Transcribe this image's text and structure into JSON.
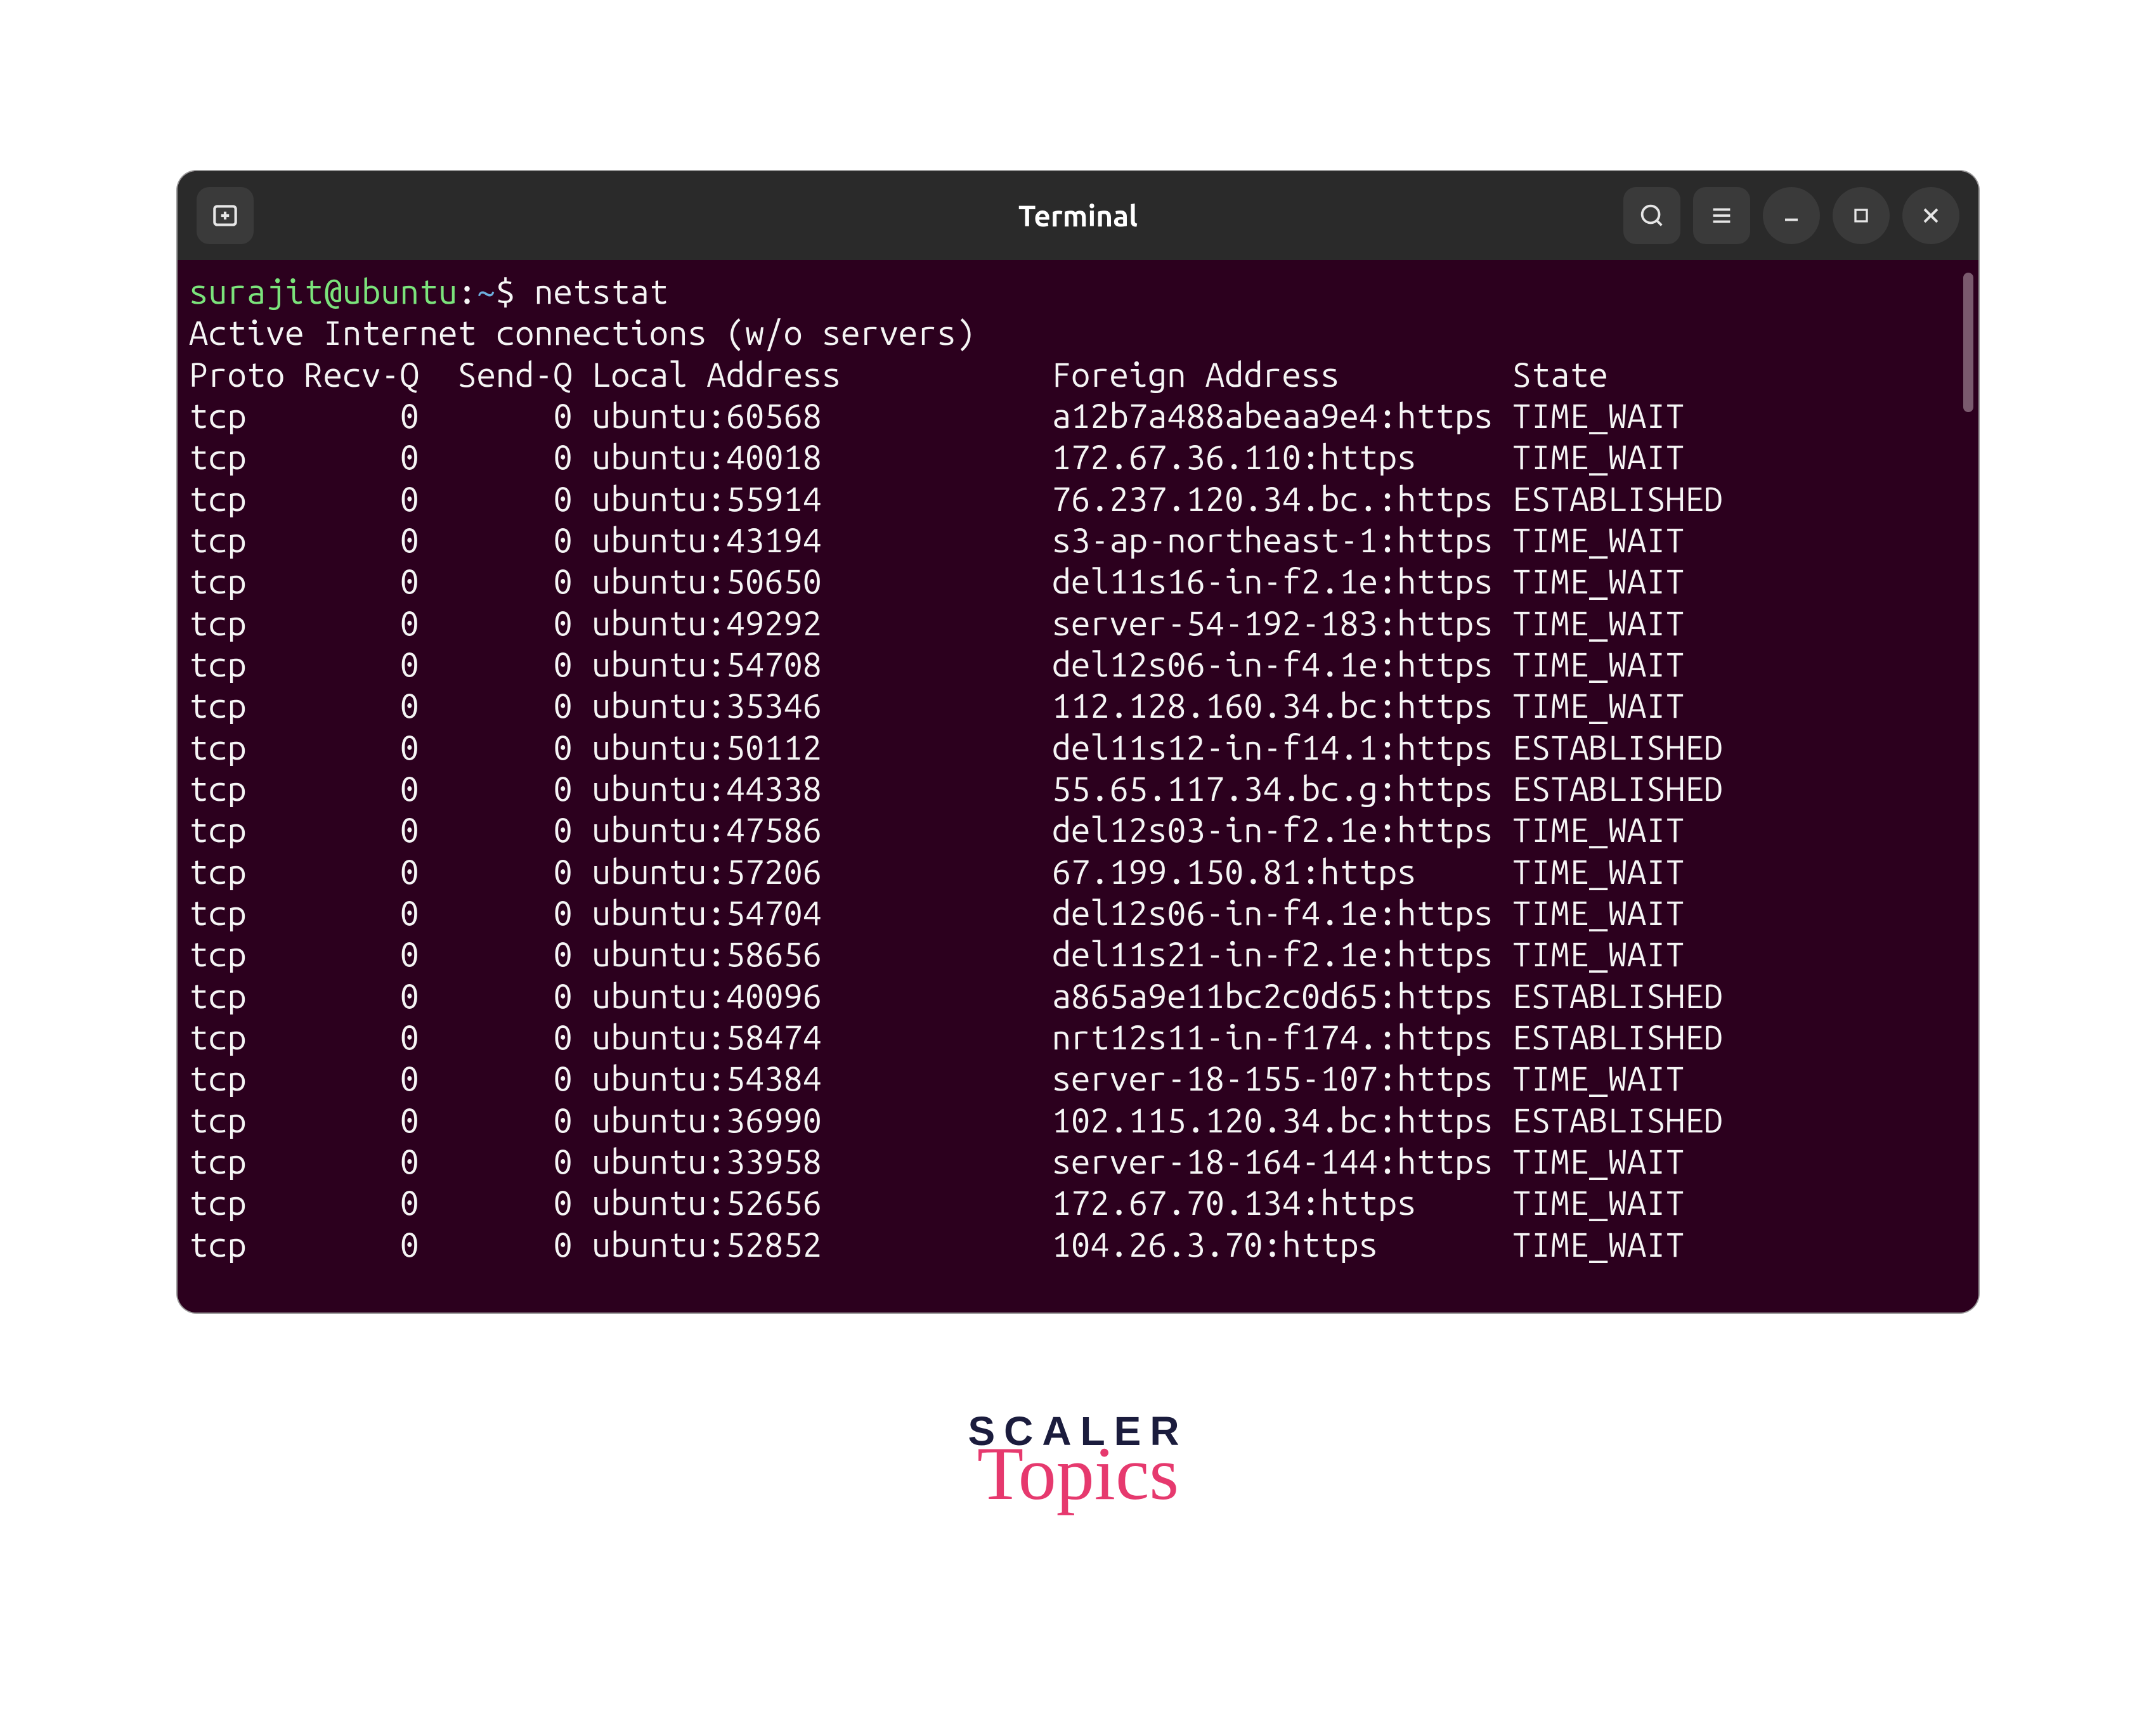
{
  "window": {
    "title": "Terminal"
  },
  "prompt": {
    "user": "surajit@ubuntu",
    "sep": ":",
    "path": "~",
    "dollar": "$",
    "command": "netstat"
  },
  "output_header": "Active Internet connections (w/o servers)",
  "columns": {
    "proto": "Proto",
    "recvq": "Recv-Q",
    "sendq": "Send-Q",
    "local": "Local Address",
    "foreign": "Foreign Address",
    "state": "State"
  },
  "rows": [
    {
      "proto": "tcp",
      "recvq": "0",
      "sendq": "0",
      "local": "ubuntu:60568",
      "foreign": "a12b7a488abeaa9e4:https",
      "state": "TIME_WAIT"
    },
    {
      "proto": "tcp",
      "recvq": "0",
      "sendq": "0",
      "local": "ubuntu:40018",
      "foreign": "172.67.36.110:https",
      "state": "TIME_WAIT"
    },
    {
      "proto": "tcp",
      "recvq": "0",
      "sendq": "0",
      "local": "ubuntu:55914",
      "foreign": "76.237.120.34.bc.:https",
      "state": "ESTABLISHED"
    },
    {
      "proto": "tcp",
      "recvq": "0",
      "sendq": "0",
      "local": "ubuntu:43194",
      "foreign": "s3-ap-northeast-1:https",
      "state": "TIME_WAIT"
    },
    {
      "proto": "tcp",
      "recvq": "0",
      "sendq": "0",
      "local": "ubuntu:50650",
      "foreign": "del11s16-in-f2.1e:https",
      "state": "TIME_WAIT"
    },
    {
      "proto": "tcp",
      "recvq": "0",
      "sendq": "0",
      "local": "ubuntu:49292",
      "foreign": "server-54-192-183:https",
      "state": "TIME_WAIT"
    },
    {
      "proto": "tcp",
      "recvq": "0",
      "sendq": "0",
      "local": "ubuntu:54708",
      "foreign": "del12s06-in-f4.1e:https",
      "state": "TIME_WAIT"
    },
    {
      "proto": "tcp",
      "recvq": "0",
      "sendq": "0",
      "local": "ubuntu:35346",
      "foreign": "112.128.160.34.bc:https",
      "state": "TIME_WAIT"
    },
    {
      "proto": "tcp",
      "recvq": "0",
      "sendq": "0",
      "local": "ubuntu:50112",
      "foreign": "del11s12-in-f14.1:https",
      "state": "ESTABLISHED"
    },
    {
      "proto": "tcp",
      "recvq": "0",
      "sendq": "0",
      "local": "ubuntu:44338",
      "foreign": "55.65.117.34.bc.g:https",
      "state": "ESTABLISHED"
    },
    {
      "proto": "tcp",
      "recvq": "0",
      "sendq": "0",
      "local": "ubuntu:47586",
      "foreign": "del12s03-in-f2.1e:https",
      "state": "TIME_WAIT"
    },
    {
      "proto": "tcp",
      "recvq": "0",
      "sendq": "0",
      "local": "ubuntu:57206",
      "foreign": "67.199.150.81:https",
      "state": "TIME_WAIT"
    },
    {
      "proto": "tcp",
      "recvq": "0",
      "sendq": "0",
      "local": "ubuntu:54704",
      "foreign": "del12s06-in-f4.1e:https",
      "state": "TIME_WAIT"
    },
    {
      "proto": "tcp",
      "recvq": "0",
      "sendq": "0",
      "local": "ubuntu:58656",
      "foreign": "del11s21-in-f2.1e:https",
      "state": "TIME_WAIT"
    },
    {
      "proto": "tcp",
      "recvq": "0",
      "sendq": "0",
      "local": "ubuntu:40096",
      "foreign": "a865a9e11bc2c0d65:https",
      "state": "ESTABLISHED"
    },
    {
      "proto": "tcp",
      "recvq": "0",
      "sendq": "0",
      "local": "ubuntu:58474",
      "foreign": "nrt12s11-in-f174.:https",
      "state": "ESTABLISHED"
    },
    {
      "proto": "tcp",
      "recvq": "0",
      "sendq": "0",
      "local": "ubuntu:54384",
      "foreign": "server-18-155-107:https",
      "state": "TIME_WAIT"
    },
    {
      "proto": "tcp",
      "recvq": "0",
      "sendq": "0",
      "local": "ubuntu:36990",
      "foreign": "102.115.120.34.bc:https",
      "state": "ESTABLISHED"
    },
    {
      "proto": "tcp",
      "recvq": "0",
      "sendq": "0",
      "local": "ubuntu:33958",
      "foreign": "server-18-164-144:https",
      "state": "TIME_WAIT"
    },
    {
      "proto": "tcp",
      "recvq": "0",
      "sendq": "0",
      "local": "ubuntu:52656",
      "foreign": "172.67.70.134:https",
      "state": "TIME_WAIT"
    },
    {
      "proto": "tcp",
      "recvq": "0",
      "sendq": "0",
      "local": "ubuntu:52852",
      "foreign": "104.26.3.70:https",
      "state": "TIME_WAIT"
    }
  ],
  "brand": {
    "line1": "SCALER",
    "line2": "Topics"
  }
}
